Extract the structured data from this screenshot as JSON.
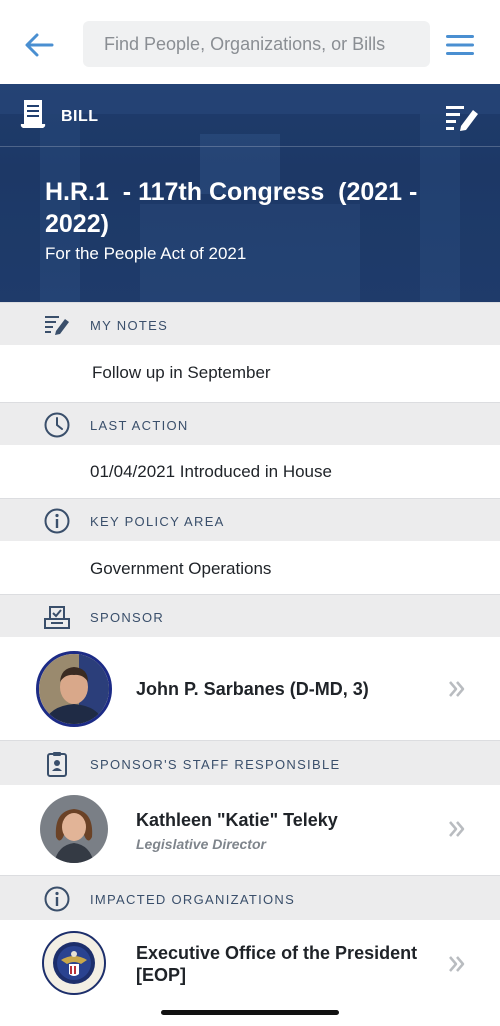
{
  "topbar": {
    "search_placeholder": "Find People, Organizations, or Bills",
    "back_icon": "arrow-left-icon",
    "menu_icon": "hamburger-menu-icon",
    "accent_color": "#4a8fd1"
  },
  "hero": {
    "type_label": "BILL",
    "title": "H.R.1  - 117th Congress  (2021 -\n2022)",
    "subtitle": "For the People Act of 2021",
    "background_color": "#213f70"
  },
  "sections": {
    "my_notes": {
      "label": "MY NOTES",
      "value": "Follow up in September",
      "icon": "notes-edit-icon"
    },
    "last_action": {
      "label": "LAST ACTION",
      "value": "01/04/2021 Introduced in House",
      "icon": "clock-icon"
    },
    "key_policy_area": {
      "label": "KEY POLICY AREA",
      "value": "Government Operations",
      "icon": "info-icon"
    },
    "sponsor": {
      "label": "SPONSOR",
      "icon": "ballot-box-icon",
      "name": "John P. Sarbanes (D-MD, 3)"
    },
    "staff": {
      "label": "SPONSOR'S STAFF RESPONSIBLE",
      "icon": "id-badge-icon",
      "name": "Kathleen \"Katie\" Teleky",
      "role": "Legislative Director"
    },
    "impacted": {
      "label": "IMPACTED ORGANIZATIONS",
      "icon": "info-icon",
      "name": "Executive Office of the President\n[EOP]"
    }
  }
}
